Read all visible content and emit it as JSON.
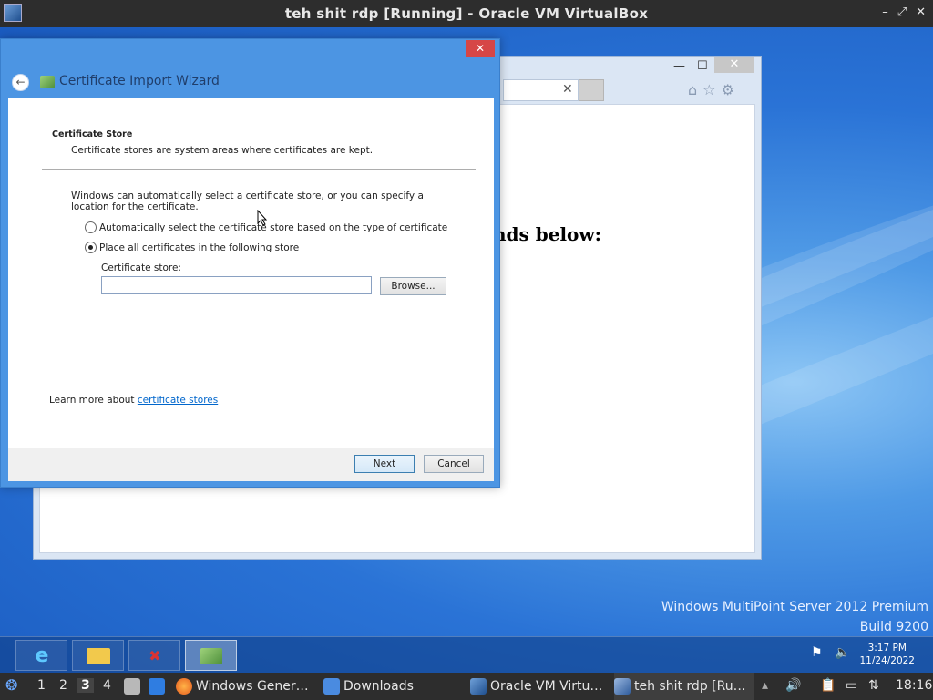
{
  "host_window": {
    "title": "teh shit rdp [Running] - Oracle VM VirtualBox",
    "controls": [
      "–",
      "⤢",
      "✕"
    ]
  },
  "browser": {
    "heading_fragment": "nds below:",
    "addr_close": "✕",
    "controls": {
      "minimize": "—",
      "maximize": "☐",
      "close": "✕"
    }
  },
  "wizard": {
    "title": "Certificate Import Wizard",
    "close": "✕",
    "back": "←",
    "section_title": "Certificate Store",
    "section_desc": "Certificate stores are system areas where certificates are kept.",
    "explanation": "Windows can automatically select a certificate store, or you can specify a location for the certificate.",
    "options": [
      {
        "label": "Automatically select the certificate store based on the type of certificate",
        "checked": false
      },
      {
        "label": "Place all certificates in the following store",
        "checked": true
      }
    ],
    "store_label": "Certificate store:",
    "store_value": "",
    "browse_label": "Browse...",
    "learn_more_prefix": "Learn more about ",
    "learn_more_link": "certificate stores",
    "next_label": "Next",
    "cancel_label": "Cancel"
  },
  "branding": {
    "line1": "Windows MultiPoint Server 2012 Premium",
    "line2": "Build 9200"
  },
  "guest_taskbar": {
    "buttons": [
      "internet-explorer",
      "file-explorer",
      "certificate-error",
      "certificate-wizard"
    ],
    "clock_time": "3:17 PM",
    "clock_date": "11/24/2022"
  },
  "host_taskbar": {
    "workspaces": [
      "1",
      "2",
      "3",
      "4"
    ],
    "current_workspace": "3",
    "items": [
      {
        "label": "Windows Gener…",
        "icon": "firefox-icon"
      },
      {
        "label": "Downloads",
        "icon": "folder-icon"
      },
      {
        "label": "Oracle VM Virtu…",
        "icon": "virtualbox-icon"
      },
      {
        "label": "teh shit rdp [Ru…",
        "icon": "virtualbox-vm-icon"
      }
    ],
    "clock": "18:16"
  }
}
